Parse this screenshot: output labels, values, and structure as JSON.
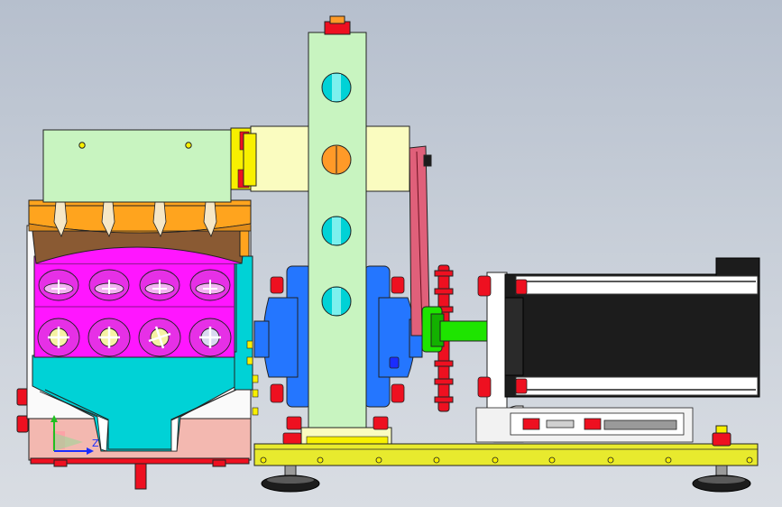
{
  "viewport": {
    "background_top": "#b6bfcd",
    "background_bottom": "#d9dde3"
  },
  "triad": {
    "axis_label": "Z",
    "y_axis_color": "#20c020",
    "z_axis_color": "#1a2cff"
  },
  "colors": {
    "hopper_magenta": "#ff16ff",
    "hopper_cyan": "#00d2d6",
    "hopper_orange": "#ffa41e",
    "pale_green": "#c8f4c0",
    "pale_yellow": "#fafcc0",
    "yellow": "#f8f000",
    "pump_blue": "#2476ff",
    "shaft_green": "#1ee400",
    "red_bolt": "#ee1020",
    "pink": "#e0607a",
    "motor_black": "#1c1c1c",
    "base_yellow": "#e8ea2e"
  }
}
